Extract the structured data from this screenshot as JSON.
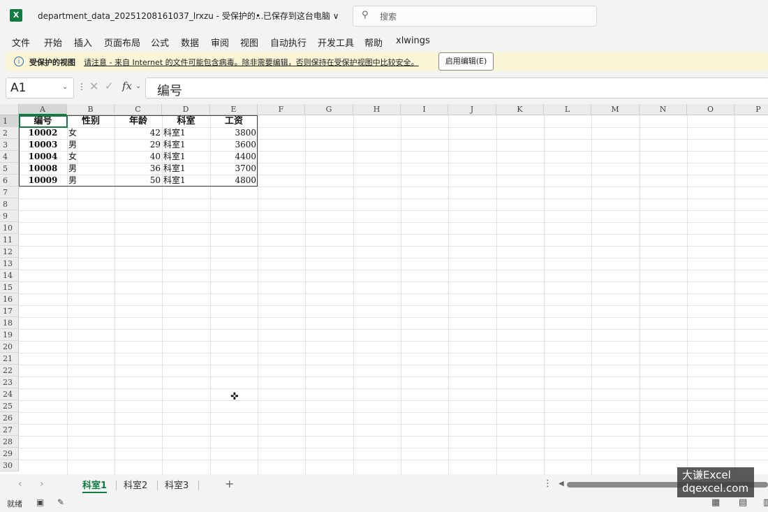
{
  "titlebar": {
    "logo_letter": "X",
    "doc_title": "department_data_20251208161037_lrxzu  -  受保护的...",
    "save_status": "• 已保存到这台电脑 ∨",
    "search_icon": "search-icon",
    "search_placeholder": "搜索"
  },
  "menu": [
    "文件",
    "开始",
    "插入",
    "页面布局",
    "公式",
    "数据",
    "审阅",
    "视图",
    "自动执行",
    "开发工具",
    "帮助",
    "xlwings"
  ],
  "protected_view": {
    "title": "受保护的视图",
    "message": "请注意 - 来自 Internet 的文件可能包含病毒。除非需要编辑，否则保持在受保护视图中比较安全。",
    "button": "启用编辑(E)"
  },
  "formula_bar": {
    "name_box": "A1",
    "fx": "fx",
    "content": "编号"
  },
  "columns": [
    "A",
    "B",
    "C",
    "D",
    "E",
    "F",
    "G",
    "H",
    "I",
    "J",
    "K",
    "L",
    "M",
    "N",
    "O",
    "P"
  ],
  "rows": [
    "1",
    "2",
    "3",
    "4",
    "5",
    "6",
    "7",
    "8",
    "9",
    "10",
    "11",
    "12",
    "13",
    "14",
    "15",
    "16",
    "17",
    "18",
    "19",
    "20",
    "21",
    "22",
    "23",
    "24",
    "25",
    "26",
    "27",
    "28",
    "29",
    "30"
  ],
  "table": {
    "headers": [
      "编号",
      "性别",
      "年龄",
      "科室",
      "工资"
    ],
    "rows": [
      [
        "10002",
        "女",
        "42",
        "科室1",
        "3800"
      ],
      [
        "10003",
        "男",
        "29",
        "科室1",
        "3600"
      ],
      [
        "10004",
        "女",
        "40",
        "科室1",
        "4400"
      ],
      [
        "10008",
        "男",
        "36",
        "科室1",
        "3700"
      ],
      [
        "10009",
        "男",
        "50",
        "科室1",
        "4800"
      ]
    ]
  },
  "sheets": {
    "tabs": [
      "科室1",
      "科室2",
      "科室3"
    ],
    "active": "科室1",
    "add": "+"
  },
  "status": {
    "ready": "就绪"
  },
  "watermark": {
    "line1": "大谦Excel",
    "line2": "dqexcel.com"
  },
  "colors": {
    "accent": "#107c41",
    "protected_bg": "#fbf5d8"
  }
}
